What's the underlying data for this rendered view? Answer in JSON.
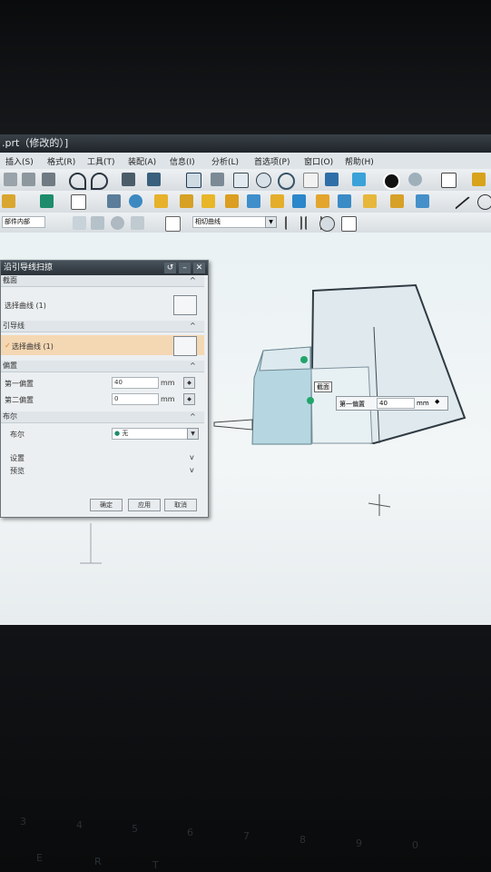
{
  "window": {
    "title": ".prt（修改的）]"
  },
  "menu": {
    "items": [
      "插入(S)",
      "格式(R)",
      "工具(T)",
      "装配(A)",
      "信息(I)",
      "分析(L)",
      "首选项(P)",
      "窗口(O)",
      "帮助(H)"
    ]
  },
  "selection_bar": {
    "filter_value": "部件内部",
    "curve_rule": "相切曲线"
  },
  "dialog": {
    "title": "沿引导线扫掠",
    "section_label": "截面",
    "section_select": "选择曲线 (1)",
    "guide_label": "引导线",
    "guide_select": "选择曲线 (1)",
    "offset_label": "偏置",
    "first_offset_label": "第一偏置",
    "first_offset_value": "40",
    "first_offset_unit": "mm",
    "second_offset_label": "第二偏置",
    "second_offset_value": "0",
    "second_offset_unit": "mm",
    "boolean_label": "布尔",
    "boolean_sub_label": "布尔",
    "boolean_value": "无",
    "settings_label": "设置",
    "preview_label": "预览",
    "ok": "确定",
    "apply": "应用",
    "cancel": "取消"
  },
  "viewport": {
    "section_tag": "截面",
    "float_offset_label": "第一偏置",
    "float_offset_value": "40",
    "float_offset_unit": "mm"
  },
  "keyboard": {
    "number_keys": [
      "3",
      "4",
      "5",
      "6",
      "7",
      "8",
      "9",
      "0"
    ],
    "letter_keys": [
      "E",
      "R",
      "T"
    ]
  }
}
